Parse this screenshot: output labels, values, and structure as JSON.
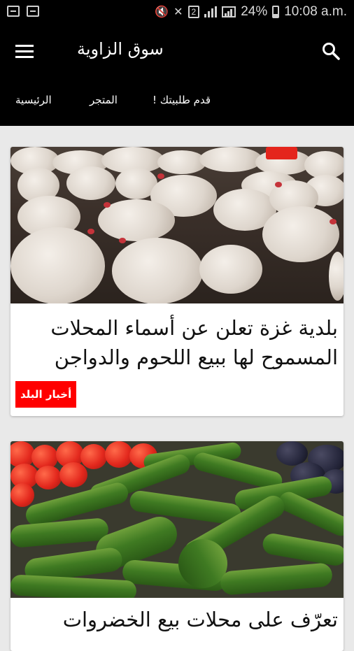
{
  "status_bar": {
    "battery_percent": "24%",
    "time": "10:08 a.m."
  },
  "app_bar": {
    "title": "سوق الزاوية",
    "icons": [
      "menu-icon",
      "search-icon"
    ]
  },
  "nav": {
    "items": [
      {
        "label": "الرئيسية"
      },
      {
        "label": "المتجر"
      },
      {
        "label": "قدم طلبيتك !"
      }
    ]
  },
  "articles": [
    {
      "title": "بلدية غزة تعلن عن أسماء المحلات المسموح لها ببيع اللحوم والدواجن",
      "category": "أخبار البلد",
      "image": "chickens-photo"
    },
    {
      "title": "تعرّف على محلات بيع الخضروات",
      "image": "vegetables-photo"
    }
  ],
  "colors": {
    "app_bar": "#000000",
    "badge": "#ff0000",
    "background": "#e9e9e9"
  }
}
